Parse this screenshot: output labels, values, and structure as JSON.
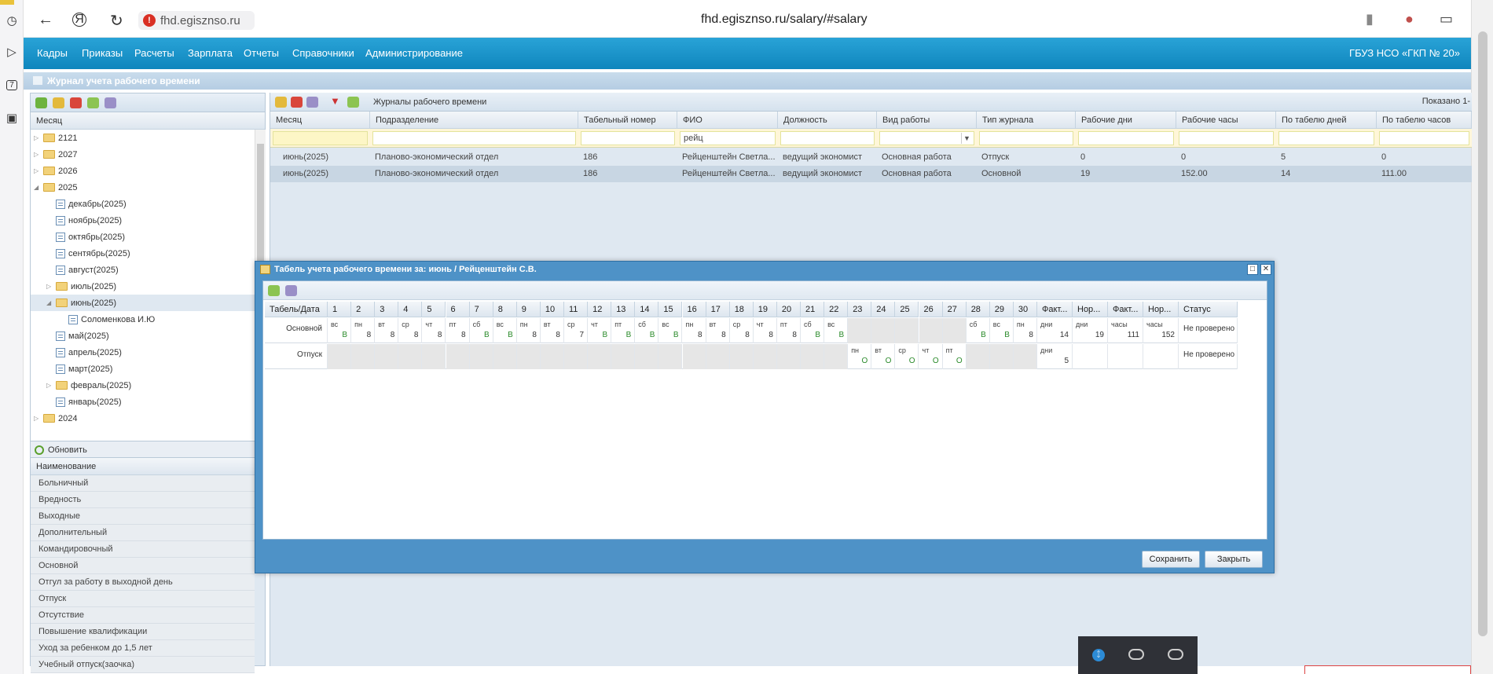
{
  "browser": {
    "url_chip": "fhd.egisznso.ru",
    "page_url": "fhd.egisznso.ru/salary/#salary"
  },
  "menu": {
    "items": [
      "Кадры",
      "Приказы",
      "Расчеты",
      "Зарплата",
      "Отчеты",
      "Справочники",
      "Администрирование"
    ],
    "org": "ГБУЗ НСО «ГКП № 20»"
  },
  "panel": {
    "title": "Журнал учета рабочего времени"
  },
  "left": {
    "month_header": "Месяц",
    "tree": [
      {
        "label": "2121",
        "kind": "folder",
        "level": 0,
        "state": "collapsed"
      },
      {
        "label": "2027",
        "kind": "folder",
        "level": 0,
        "state": "collapsed"
      },
      {
        "label": "2026",
        "kind": "folder",
        "level": 0,
        "state": "collapsed"
      },
      {
        "label": "2025",
        "kind": "folder",
        "level": 0,
        "state": "expanded"
      },
      {
        "label": "декабрь(2025)",
        "kind": "sheet",
        "level": 1
      },
      {
        "label": "ноябрь(2025)",
        "kind": "sheet",
        "level": 1
      },
      {
        "label": "октябрь(2025)",
        "kind": "sheet",
        "level": 1
      },
      {
        "label": "сентябрь(2025)",
        "kind": "sheet",
        "level": 1
      },
      {
        "label": "август(2025)",
        "kind": "sheet",
        "level": 1
      },
      {
        "label": "июль(2025)",
        "kind": "folder",
        "level": 1,
        "state": "collapsed"
      },
      {
        "label": "июнь(2025)",
        "kind": "folder",
        "level": 1,
        "state": "expanded",
        "selected": true
      },
      {
        "label": "Соломенкова И.Ю",
        "kind": "sheet",
        "level": 2
      },
      {
        "label": "май(2025)",
        "kind": "sheet",
        "level": 1
      },
      {
        "label": "апрель(2025)",
        "kind": "sheet",
        "level": 1
      },
      {
        "label": "март(2025)",
        "kind": "sheet",
        "level": 1
      },
      {
        "label": "февраль(2025)",
        "kind": "folder",
        "level": 1,
        "state": "collapsed"
      },
      {
        "label": "январь(2025)",
        "kind": "sheet",
        "level": 1
      },
      {
        "label": "2024",
        "kind": "folder",
        "level": 0,
        "state": "collapsed"
      }
    ],
    "refresh_label": "Обновить",
    "types_header": "Наименование",
    "types": [
      "Больничный",
      "Вредность",
      "Выходные",
      "Дополнительный",
      "Командировочный",
      "Основной",
      "Отгул за работу в выходной день",
      "Отпуск",
      "Отсутствие",
      "Повышение квалификации",
      "Уход за ребенком до 1,5 лет",
      "Учебный отпуск(заочка)"
    ]
  },
  "grid": {
    "toolbar_label": "Журналы рабочего времени",
    "shown_label": "Показано 1-",
    "columns": [
      "Месяц",
      "Подразделение",
      "Табельный номер",
      "ФИО",
      "Должность",
      "Вид работы",
      "Тип журнала",
      "Рабочие дни",
      "Рабочие часы",
      "По табелю дней",
      "По табелю часов"
    ],
    "filters": [
      "",
      "",
      "",
      "рейц",
      "",
      "",
      "",
      "",
      "",
      "",
      ""
    ],
    "rows": [
      [
        "июнь(2025)",
        "Планово-экономический отдел",
        "186",
        "Рейценштейн Светла...",
        "ведущий экономист",
        "Основная работа",
        "Отпуск",
        "0",
        "0",
        "5",
        "0"
      ],
      [
        "июнь(2025)",
        "Планово-экономический отдел",
        "186",
        "Рейценштейн Светла...",
        "ведущий экономист",
        "Основная работа",
        "Основной",
        "19",
        "152.00",
        "14",
        "111.00"
      ]
    ]
  },
  "dialog": {
    "title": "Табель учета рабочего времени за: июнь / Рейценштейн С.В.",
    "first_col_header": "Табель/Дата",
    "day_headers": [
      "1",
      "2",
      "3",
      "4",
      "5",
      "6",
      "7",
      "8",
      "9",
      "10",
      "11",
      "12",
      "13",
      "14",
      "15",
      "16",
      "17",
      "18",
      "19",
      "20",
      "21",
      "22",
      "23",
      "24",
      "25",
      "26",
      "27",
      "28",
      "29",
      "30"
    ],
    "summary_headers": [
      "Факт...",
      "Нор...",
      "Факт...",
      "Нор...",
      "Статус"
    ],
    "weekdays": [
      "вс",
      "пн",
      "вт",
      "ср",
      "чт",
      "пт",
      "сб",
      "вс",
      "пн",
      "вт",
      "ср",
      "чт",
      "пт",
      "сб",
      "вс",
      "пн",
      "вт",
      "ср",
      "чт",
      "пт",
      "сб",
      "вс",
      "пн",
      "вт",
      "ср",
      "чт",
      "пт",
      "сб",
      "вс",
      "пн"
    ],
    "rows": [
      {
        "label": "Основной",
        "values": [
          "В",
          "8",
          "8",
          "8",
          "8",
          "8",
          "В",
          "В",
          "8",
          "8",
          "7",
          "В",
          "В",
          "В",
          "В",
          "8",
          "8",
          "8",
          "8",
          "8",
          "В",
          "В",
          "",
          "",
          "",
          "",
          "",
          "В",
          "В",
          "8"
        ],
        "summary": [
          {
            "unit": "дни",
            "value": "14"
          },
          {
            "unit": "дни",
            "value": "19"
          },
          {
            "unit": "часы",
            "value": "111"
          },
          {
            "unit": "часы",
            "value": "152"
          }
        ],
        "status": "Не проверено"
      },
      {
        "label": "Отпуск",
        "active_days": [
          23,
          24,
          25,
          26,
          27
        ],
        "values_active": [
          "О",
          "О",
          "О",
          "О",
          "О"
        ],
        "summary": [
          {
            "unit": "дни",
            "value": "5"
          },
          {
            "unit": "",
            "value": ""
          },
          {
            "unit": "",
            "value": ""
          },
          {
            "unit": "",
            "value": ""
          }
        ],
        "status": "Не проверено"
      }
    ],
    "save_label": "Сохранить",
    "close_label": "Закрыть"
  },
  "colors": {
    "menu_bar": "#1a97cc",
    "panel_bg": "#dfe8f1",
    "dialog_frame": "#4e92c7",
    "day_value_green": "#2a8a2a"
  }
}
